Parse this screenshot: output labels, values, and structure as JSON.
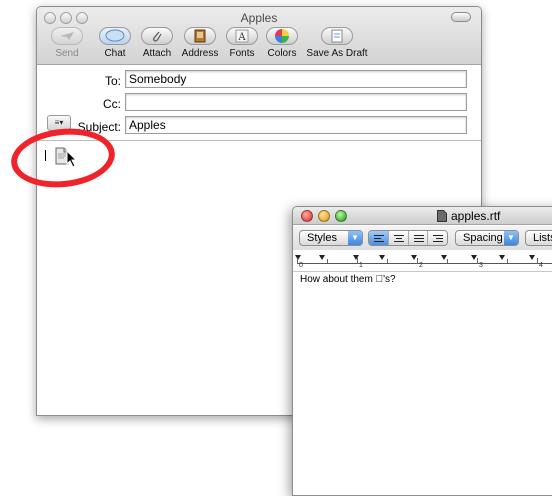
{
  "mail": {
    "title": "Apples",
    "toolbar": [
      {
        "label": "Send",
        "icon": "send-icon",
        "enabled": false
      },
      {
        "label": "Chat",
        "icon": "chat-icon",
        "enabled": true
      },
      {
        "label": "Attach",
        "icon": "paperclip-icon",
        "enabled": true
      },
      {
        "label": "Address",
        "icon": "address-book-icon",
        "enabled": true
      },
      {
        "label": "Fonts",
        "icon": "fonts-icon",
        "enabled": true
      },
      {
        "label": "Colors",
        "icon": "color-wheel-icon",
        "enabled": true
      },
      {
        "label": "Save As Draft",
        "icon": "draft-icon",
        "enabled": true
      }
    ],
    "fields": {
      "to_label": "To:",
      "to_value": "Somebody",
      "cc_label": "Cc:",
      "cc_value": "",
      "subject_label": "Subject:",
      "subject_value": "Apples"
    }
  },
  "textedit": {
    "title": "apples.rtf",
    "styles_label": "Styles",
    "spacing_label": "Spacing",
    "lists_label": "Lists",
    "ruler_numbers": [
      "0",
      "1",
      "2",
      "3",
      "4"
    ],
    "body_text": "How about them 's?"
  },
  "colors": {
    "annotation_circle": "#f0232b",
    "close_light": "#ec5b52",
    "minimize_light": "#f2b53d",
    "zoom_light": "#59c144",
    "accent_blue": "#4b8fe2"
  }
}
